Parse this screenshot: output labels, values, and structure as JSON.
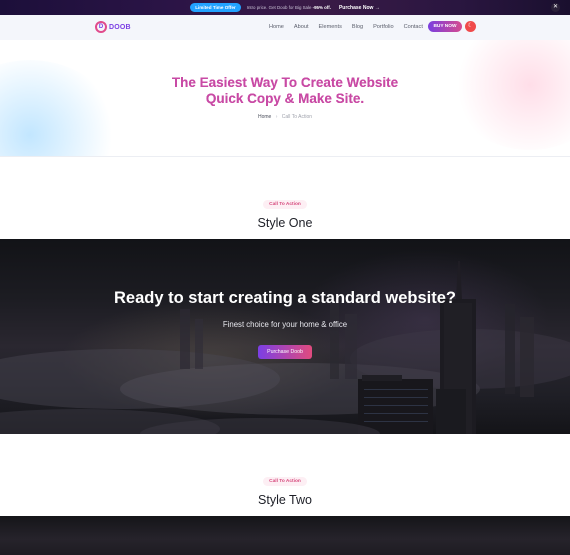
{
  "promo": {
    "badge": "Limited Time Offer",
    "text": "Intro price. Get Doob for Big Sale",
    "discount": "-95% off.",
    "link": "Purchase Now",
    "close_icon": "close-icon"
  },
  "header": {
    "logo_mark": "D",
    "logo_text": "DOOB",
    "nav": [
      "Home",
      "About",
      "Elements",
      "Blog",
      "Portfolio",
      "Contact"
    ],
    "buy_label": "BUY NOW",
    "toggle_icon": "moon-icon"
  },
  "hero": {
    "title_line1": "The Easiest Way To Create Website",
    "title_line2": "Quick Copy & Make Site.",
    "breadcrumb_home": "Home",
    "breadcrumb_sep": "›",
    "breadcrumb_current": "Call To Action"
  },
  "section_one": {
    "pill": "Call To Action",
    "title": "Style One"
  },
  "cta": {
    "title": "Ready to start creating a standard website?",
    "subtitle": "Finest choice for your home & office",
    "button": "Purchase Doob"
  },
  "section_two": {
    "pill": "Call To Action",
    "title": "Style Two"
  },
  "colors": {
    "accent_purple": "#7b3fe4",
    "accent_pink": "#e14b7e",
    "promo_badge": "#22a2ff"
  }
}
